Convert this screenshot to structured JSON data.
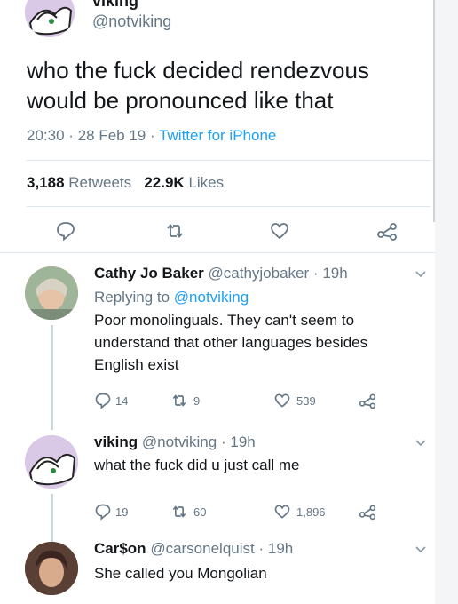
{
  "main_tweet": {
    "name_partial": "viking",
    "handle": "@notviking",
    "text": "who the fuck decided rendezvous would be pronounced like that",
    "time": "20:30",
    "date": "28 Feb 19",
    "via": "Twitter for iPhone",
    "retweets_count": "3,188",
    "retweets_label": "Retweets",
    "likes_count": "22.9K",
    "likes_label": "Likes",
    "action_icons": [
      "reply-icon",
      "retweet-icon",
      "like-icon",
      "share-icon"
    ]
  },
  "replies": [
    {
      "name": "Cathy Jo Baker",
      "handle": "@cathyjobaker",
      "age": "19h",
      "replying_prefix": "Replying to",
      "replying_to": "@notviking",
      "lines": [
        "Poor monolinguals. They can't seem to",
        "understand that other languages besides",
        "English exist"
      ],
      "reply_count": "14",
      "retweet_count": "9",
      "like_count": "539"
    },
    {
      "name": "viking",
      "handle": "@notviking",
      "age": "19h",
      "lines": [
        "what the fuck did u just call me"
      ],
      "reply_count": "19",
      "retweet_count": "60",
      "like_count": "1,896"
    },
    {
      "name": "Car$on",
      "handle": "@carsonelquist",
      "age": "19h",
      "lines": [
        "She called you Mongolian"
      ]
    }
  ],
  "separator": "·",
  "colors": {
    "text": "#14171a",
    "secondary": "#657786",
    "link": "#1da1f2",
    "divider": "#e1e8ed",
    "thread_line": "#ccd6dd"
  }
}
